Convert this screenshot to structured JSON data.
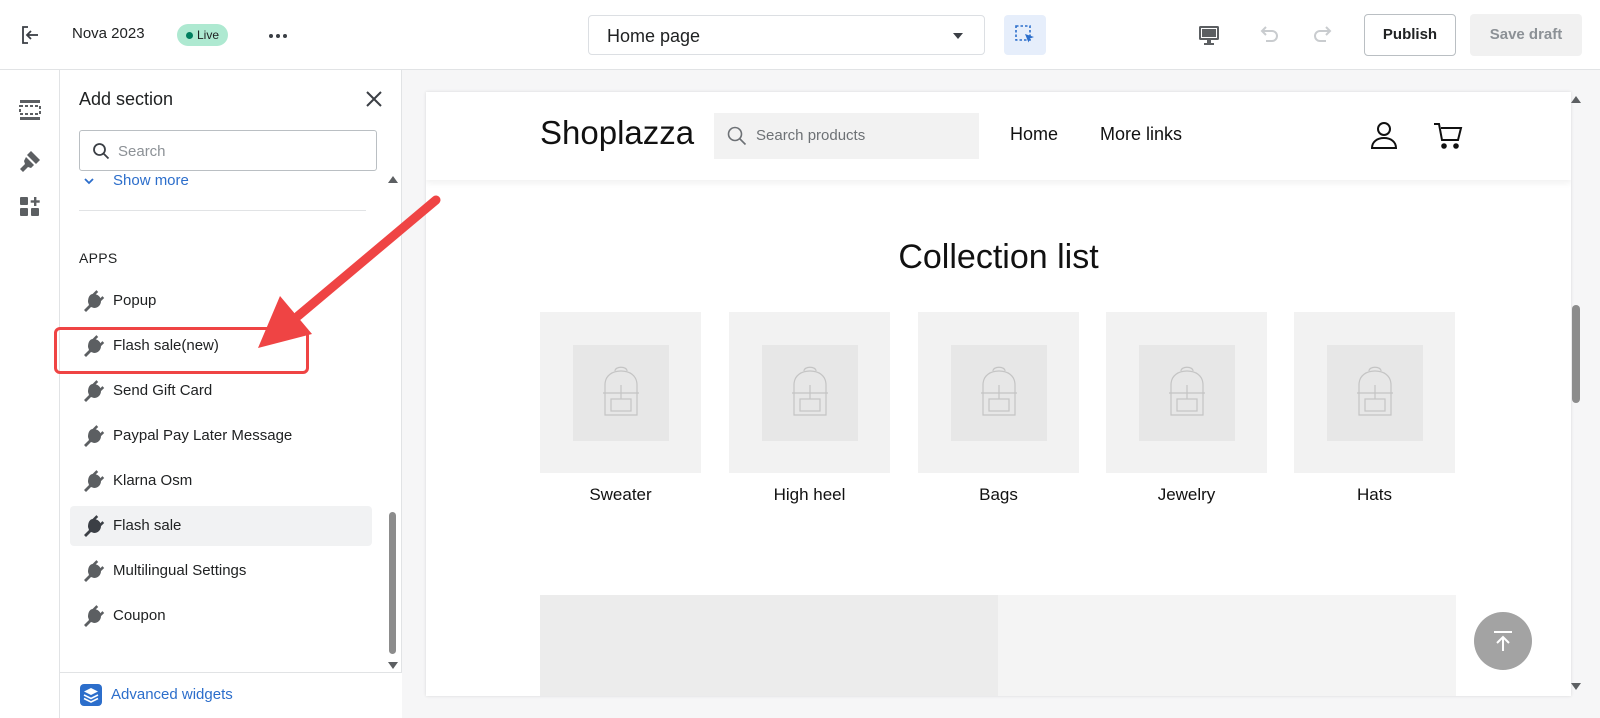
{
  "topbar": {
    "store_name": "Nova 2023",
    "status_badge": "Live",
    "page_selector": "Home page",
    "publish_label": "Publish",
    "save_draft_label": "Save draft"
  },
  "panel": {
    "title": "Add section",
    "search_placeholder": "Search",
    "show_more": "Show more",
    "apps_heading": "APPS",
    "apps": [
      {
        "label": "Popup"
      },
      {
        "label": "Flash sale(new)"
      },
      {
        "label": "Send Gift Card"
      },
      {
        "label": "Paypal Pay Later Message"
      },
      {
        "label": "Klarna Osm"
      },
      {
        "label": "Flash sale"
      },
      {
        "label": "Multilingual Settings"
      },
      {
        "label": "Coupon"
      }
    ],
    "footer_link": "Advanced widgets"
  },
  "preview": {
    "logo": "Shoplazza",
    "search_placeholder": "Search products",
    "nav": [
      "Home",
      "More links"
    ],
    "collection_title": "Collection list",
    "collections": [
      "Sweater",
      "High heel",
      "Bags",
      "Jewelry",
      "Hats"
    ]
  },
  "colors": {
    "accent": "#2c6ecb",
    "live_badge": "#aee9d1",
    "annotation": "#ef4444"
  },
  "icons": {
    "rail": [
      "sections-icon",
      "theme-settings-icon",
      "apps-icon"
    ],
    "app_item": "plug-icon"
  }
}
